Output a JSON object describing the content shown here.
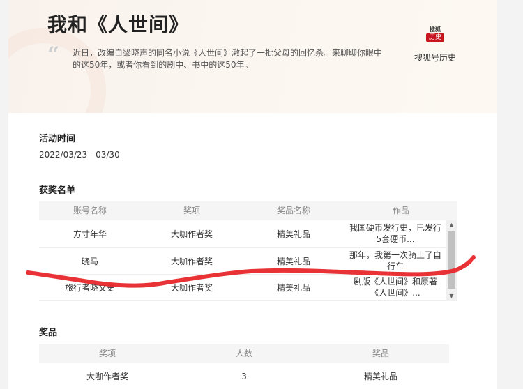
{
  "header": {
    "title": "我和《人世间》",
    "quote_mark": "“",
    "description": "近日，改编自梁晓声的同名小说《人世间》激起了一批父母的回忆杀。来聊聊你眼中的这50年，或者你看到的剧中、书中的这50年。",
    "brand_logo_top": "搜狐",
    "brand_logo_seal": "历史",
    "brand_name": "搜狐号历史"
  },
  "activity": {
    "title": "活动时间",
    "date_range": "2022/03/23 - 03/30"
  },
  "winners": {
    "title": "获奖名单",
    "columns": [
      "账号名称",
      "奖项",
      "奖品名称",
      "作品"
    ],
    "rows": [
      [
        "方寸年华",
        "大咖作者奖",
        "精美礼品",
        "我国硬币发行史，已发行5套硬币..."
      ],
      [
        "晓马",
        "大咖作者奖",
        "精美礼品",
        "那年，我第一次骑上了自行车"
      ],
      [
        "旅行者晓文史",
        "大咖作者奖",
        "精美礼品",
        "剧版《人世间》和原著《人世间》..."
      ]
    ]
  },
  "prizes": {
    "title": "奖品",
    "columns": [
      "奖项",
      "人数",
      "奖品"
    ],
    "rows": [
      [
        "大咖作者奖",
        "3",
        "精美礼品"
      ]
    ]
  },
  "colors": {
    "accent_red": "#e8272b",
    "seal_red": "#c8161e"
  }
}
